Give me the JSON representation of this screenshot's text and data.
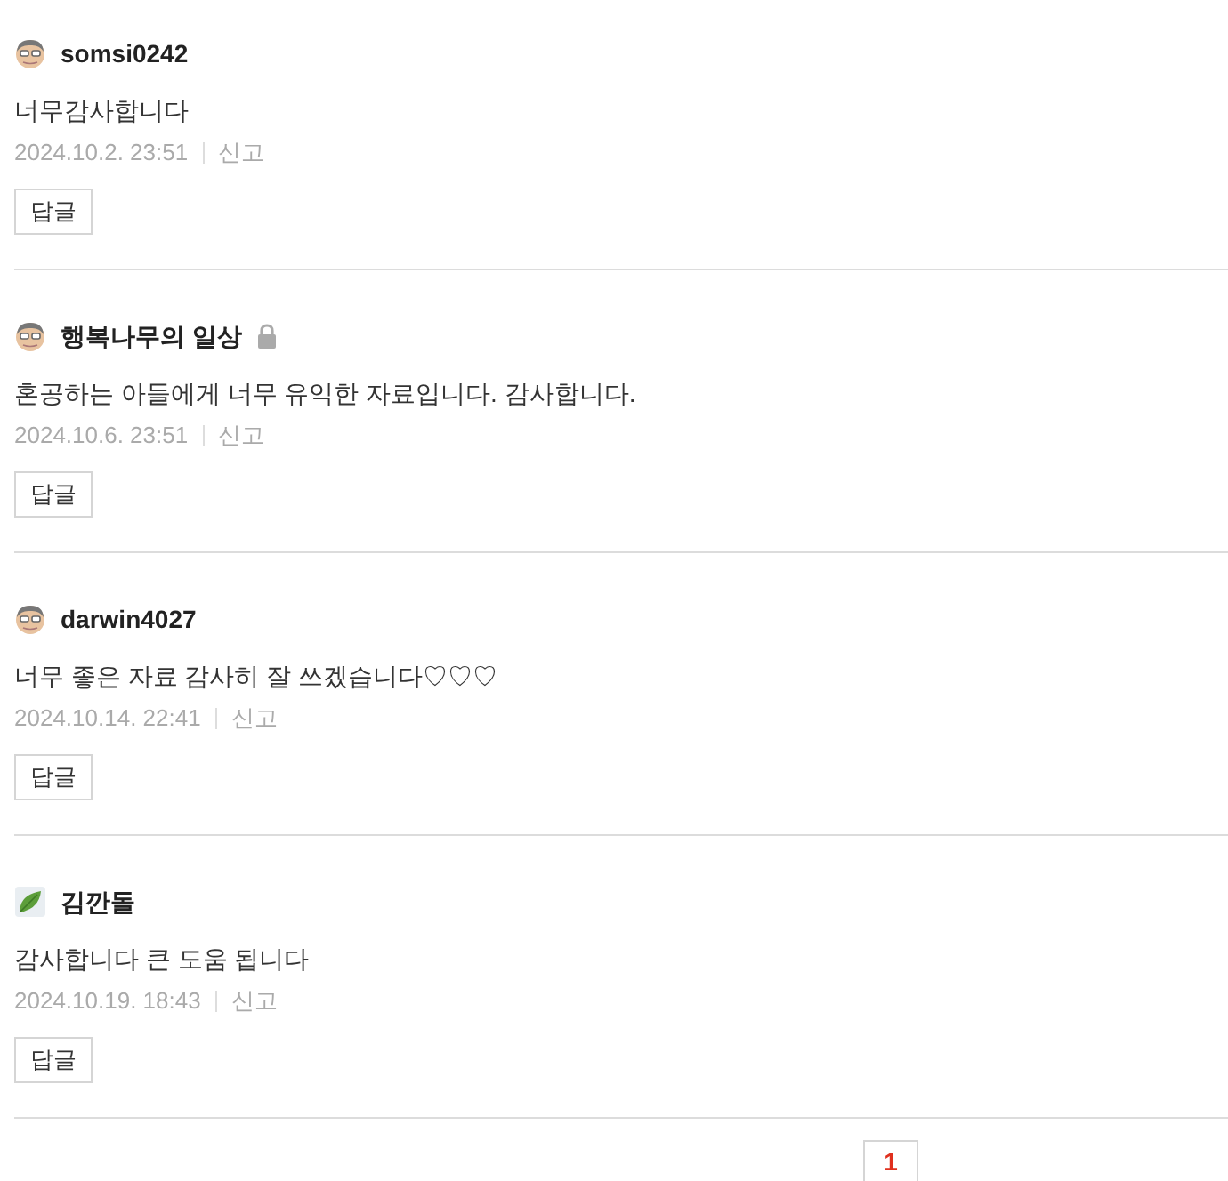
{
  "comments": [
    {
      "kind": "face",
      "author": "somsi0242",
      "locked": false,
      "text": "너무감사합니다",
      "date": "2024.10.2. 23:51",
      "report": "신고",
      "reply": "답글"
    },
    {
      "kind": "face",
      "author": "행복나무의 일상",
      "locked": true,
      "text": "혼공하는 아들에게 너무 유익한 자료입니다. 감사합니다.",
      "date": "2024.10.6. 23:51",
      "report": "신고",
      "reply": "답글"
    },
    {
      "kind": "face",
      "author": "darwin4027",
      "locked": false,
      "text": "너무 좋은 자료 감사히 잘 쓰겠습니다♡♡♡",
      "date": "2024.10.14. 22:41",
      "report": "신고",
      "reply": "답글"
    },
    {
      "kind": "leaf",
      "author": "김깐돌",
      "locked": false,
      "text": "감사합니다 큰 도움 됩니다",
      "date": "2024.10.19. 18:43",
      "report": "신고",
      "reply": "답글"
    }
  ],
  "pagination": [
    {
      "label": "1",
      "selected": true
    }
  ]
}
